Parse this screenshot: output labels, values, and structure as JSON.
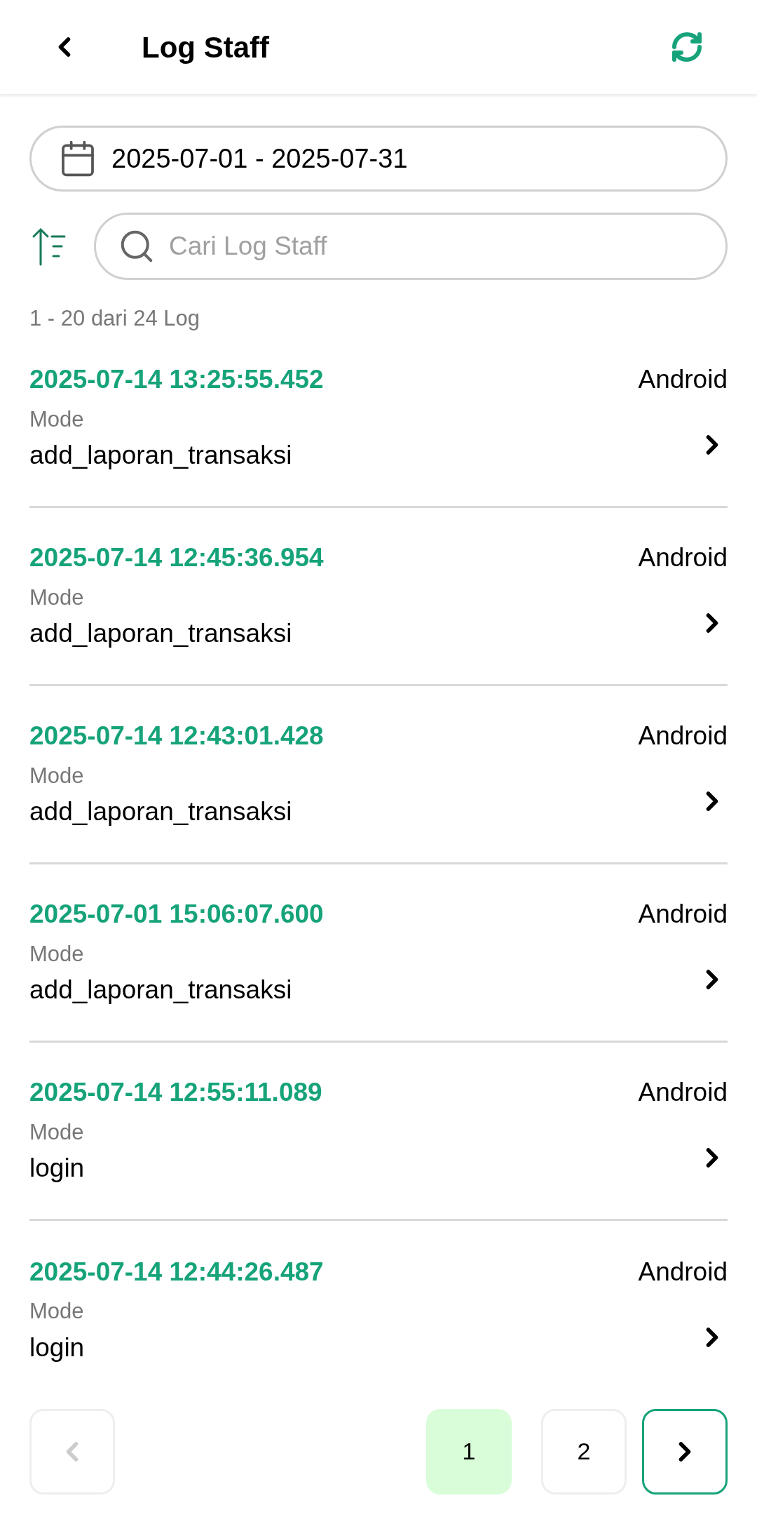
{
  "header": {
    "title": "Log Staff"
  },
  "date_range": {
    "value": "2025-07-01 - 2025-07-31"
  },
  "search": {
    "placeholder": "Cari Log Staff"
  },
  "count": "1 - 20 dari 24 Log",
  "logs": [
    {
      "time": "2025-07-14 13:25:55.452",
      "platform": "Android",
      "mode_label": "Mode",
      "mode": "add_laporan_transaksi"
    },
    {
      "time": "2025-07-14 12:45:36.954",
      "platform": "Android",
      "mode_label": "Mode",
      "mode": "add_laporan_transaksi"
    },
    {
      "time": "2025-07-14 12:43:01.428",
      "platform": "Android",
      "mode_label": "Mode",
      "mode": "add_laporan_transaksi"
    },
    {
      "time": "2025-07-01 15:06:07.600",
      "platform": "Android",
      "mode_label": "Mode",
      "mode": "add_laporan_transaksi"
    },
    {
      "time": "2025-07-14 12:55:11.089",
      "platform": "Android",
      "mode_label": "Mode",
      "mode": "login"
    },
    {
      "time": "2025-07-14 12:44:26.487",
      "platform": "Android",
      "mode_label": "Mode",
      "mode": "login"
    }
  ],
  "pagination": {
    "prev_disabled": true,
    "next_disabled": false,
    "pages": [
      {
        "label": "1",
        "selected": true
      },
      {
        "label": "2",
        "selected": false
      }
    ]
  }
}
